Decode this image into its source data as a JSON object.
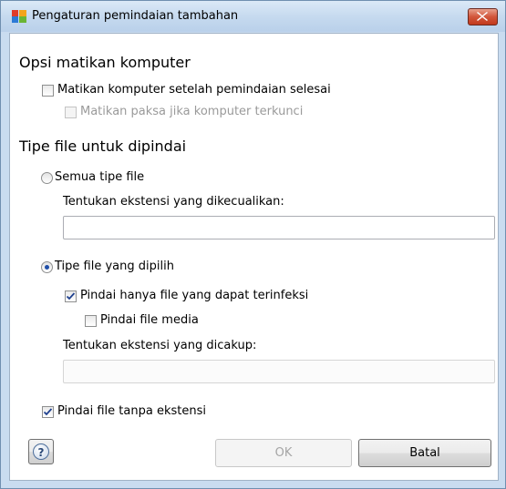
{
  "window": {
    "title": "Pengaturan pemindaian tambahan",
    "icon": "avg-logo-icon"
  },
  "shutdown": {
    "heading": "Opsi matikan komputer",
    "shutdown_after_scan": {
      "label": "Matikan komputer setelah pemindaian selesai",
      "checked": false,
      "enabled": true
    },
    "force_shutdown": {
      "label": "Matikan paksa jika komputer terkunci",
      "checked": false,
      "enabled": false
    }
  },
  "file_types": {
    "heading": "Tipe file untuk dipindai",
    "all_types": {
      "label": "Semua tipe file",
      "selected": false
    },
    "excluded_ext": {
      "label": "Tentukan ekstensi yang dikecualikan:",
      "value": ""
    },
    "selected_types": {
      "label": "Tipe file yang dipilih",
      "selected": true
    },
    "infectable_only": {
      "label": "Pindai hanya file yang dapat terinfeksi",
      "checked": true
    },
    "media_files": {
      "label": "Pindai file media",
      "checked": false
    },
    "included_ext": {
      "label": "Tentukan ekstensi yang dicakup:",
      "value": "",
      "enabled": false
    },
    "no_extension": {
      "label": "Pindai file tanpa ekstensi",
      "checked": true
    }
  },
  "buttons": {
    "help": "?",
    "ok": "OK",
    "cancel": "Batal"
  }
}
